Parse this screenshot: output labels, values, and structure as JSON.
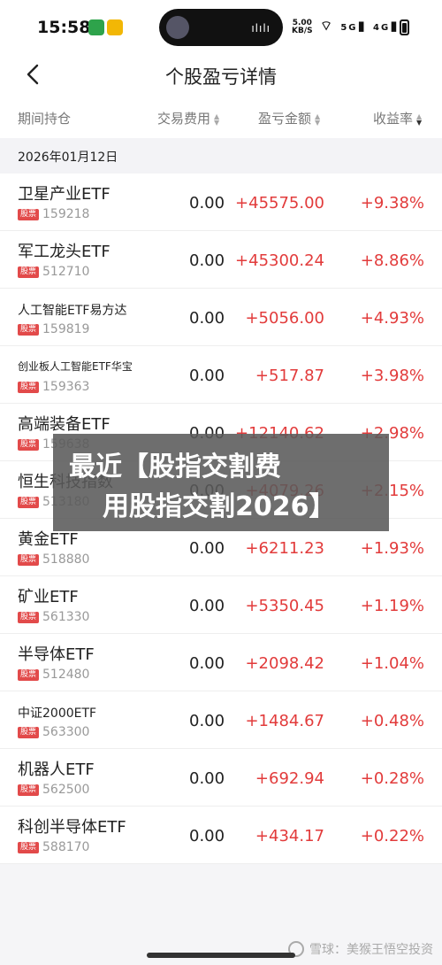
{
  "status_bar": {
    "time": "15:58",
    "net_speed_value": "5.00",
    "net_speed_unit": "KB/S",
    "signal_text": "5G",
    "signal_text2": "4G",
    "island_wave": "ılılı"
  },
  "header": {
    "title": "个股盈亏详情"
  },
  "columns": {
    "name": "期间持仓",
    "fee": "交易费用",
    "pnl": "盈亏金额",
    "rate": "收益率"
  },
  "date": "2026年01月12日",
  "badge_label": "股票",
  "rows": [
    {
      "name": "卫星产业ETF",
      "code": "159218",
      "fee": "0.00",
      "pnl": "+45575.00",
      "rate": "+9.38%"
    },
    {
      "name": "军工龙头ETF",
      "code": "512710",
      "fee": "0.00",
      "pnl": "+45300.24",
      "rate": "+8.86%"
    },
    {
      "name": "人工智能ETF易方达",
      "code": "159819",
      "fee": "0.00",
      "pnl": "+5056.00",
      "rate": "+4.93%"
    },
    {
      "name": "创业板人工智能ETF华宝",
      "code": "159363",
      "fee": "0.00",
      "pnl": "+517.87",
      "rate": "+3.98%"
    },
    {
      "name": "高端装备ETF",
      "code": "159638",
      "fee": "0.00",
      "pnl": "+12140.62",
      "rate": "+2.98%"
    },
    {
      "name": "恒生科技指数",
      "code": "513180",
      "fee": "0.00",
      "pnl": "+4079.26",
      "rate": "+2.15%"
    },
    {
      "name": "黄金ETF",
      "code": "518880",
      "fee": "0.00",
      "pnl": "+6211.23",
      "rate": "+1.93%"
    },
    {
      "name": "矿业ETF",
      "code": "561330",
      "fee": "0.00",
      "pnl": "+5350.45",
      "rate": "+1.19%"
    },
    {
      "name": "半导体ETF",
      "code": "512480",
      "fee": "0.00",
      "pnl": "+2098.42",
      "rate": "+1.04%"
    },
    {
      "name": "中证2000ETF",
      "code": "563300",
      "fee": "0.00",
      "pnl": "+1484.67",
      "rate": "+0.48%"
    },
    {
      "name": "机器人ETF",
      "code": "562500",
      "fee": "0.00",
      "pnl": "+692.94",
      "rate": "+0.28%"
    },
    {
      "name": "科创半导体ETF",
      "code": "588170",
      "fee": "0.00",
      "pnl": "+434.17",
      "rate": "+0.22%"
    }
  ],
  "overlay_banner": {
    "line1": "最近【股指交割费",
    "line2": "用股指交割2026】"
  },
  "watermark": "雪球：美猴王悟空投资",
  "colors": {
    "gain": "#e23b3b",
    "badge": "#e24a4a"
  }
}
